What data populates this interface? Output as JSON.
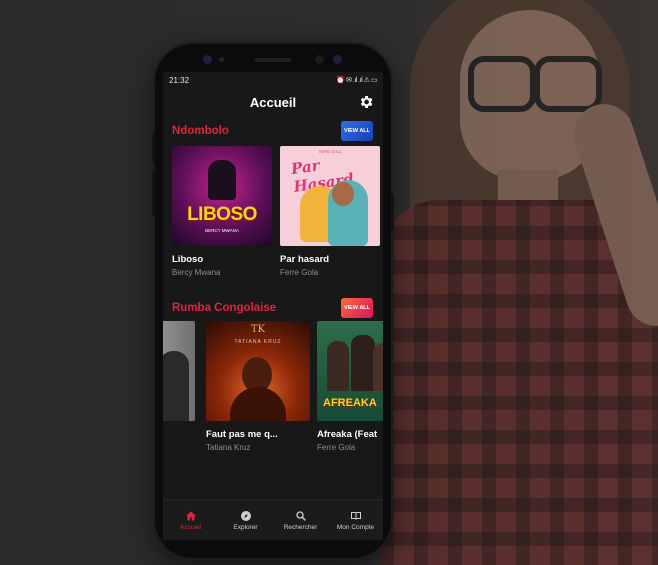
{
  "status": {
    "time": "21:32",
    "icons": "⏰ ✉ .ıl .ıl ⚠ ▭"
  },
  "header": {
    "title": "Accueil"
  },
  "sections": [
    {
      "title": "Ndombolo",
      "view_all": "VIEW ALL",
      "items": [
        {
          "title": "Liboso",
          "artist": "Bercy Mwana",
          "cover_text": "LIBOSO",
          "cover_sub": "BERCY MWANA"
        },
        {
          "title": "Par hasard",
          "artist": "Ferre Gola",
          "cover_text": "Par Hasard",
          "cover_sub": "FERRE GOLA"
        }
      ]
    },
    {
      "title": "Rumba Congolaise",
      "view_all": "VIEW ALL",
      "items": [
        {
          "title": "",
          "artist": ""
        },
        {
          "title": "Faut pas me q...",
          "artist": "Tatiana Kruz",
          "cover_text": "TATIANA KRUZ",
          "cover_sub": "TK"
        },
        {
          "title": "Afreaka (Feat",
          "artist": "Ferre Gola",
          "cover_text": "AFREAKA"
        }
      ]
    }
  ],
  "nav": [
    {
      "label": "Accueil",
      "icon": "home-icon",
      "active": true
    },
    {
      "label": "Explorer",
      "icon": "compass-icon",
      "active": false
    },
    {
      "label": "Rechercher",
      "icon": "search-icon",
      "active": false
    },
    {
      "label": "Mon Compte",
      "icon": "book-icon",
      "active": false
    }
  ],
  "colors": {
    "accent": "#e2233d",
    "background": "#181818",
    "view_all_blue": "#2f6ee8",
    "view_all_red": "#ff4a4a"
  }
}
